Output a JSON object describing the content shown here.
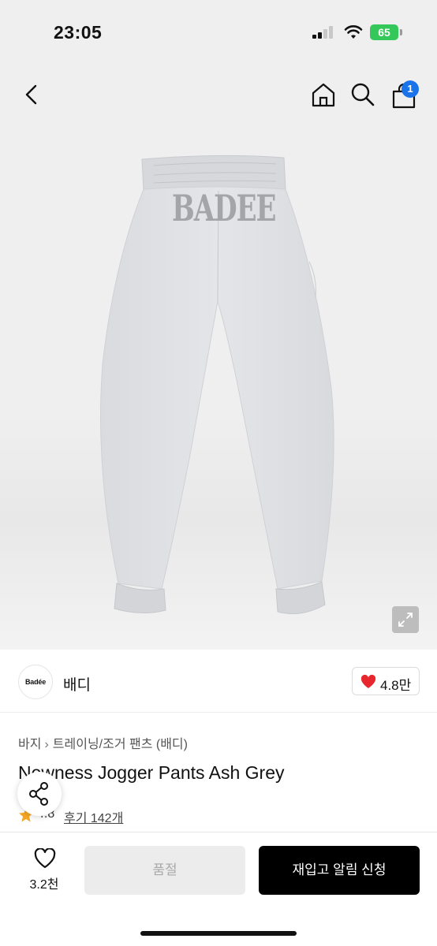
{
  "status_bar": {
    "time": "23:05",
    "battery": "65",
    "icons": [
      "cellular-signal-icon",
      "wifi-icon",
      "battery-icon"
    ]
  },
  "nav": {
    "icons": [
      "back-icon",
      "home-icon",
      "search-icon",
      "cart-icon"
    ],
    "cart_count": "1"
  },
  "product_image": {
    "brand_print": "BADEE",
    "icons": [
      "expand-icon"
    ]
  },
  "brand": {
    "logo_text": "Badée",
    "name": "배디",
    "likes": "4.8만"
  },
  "breadcrumb": {
    "category": "바지",
    "subcategory": "트레이닝/조거 팬츠 (배디)"
  },
  "product": {
    "title": "Newness Jogger Pants Ash Grey",
    "rating": "4.8",
    "review_link": "후기 142개"
  },
  "bottom_bar": {
    "wish_count": "3.2천",
    "soldout_label": "품절",
    "restock_label": "재입고 알림 신청"
  },
  "colors": {
    "header_bg": "#efefef",
    "badge": "#1a73e8",
    "heart": "#e8262e",
    "star": "#f5a623",
    "primary_button": "#000000"
  }
}
